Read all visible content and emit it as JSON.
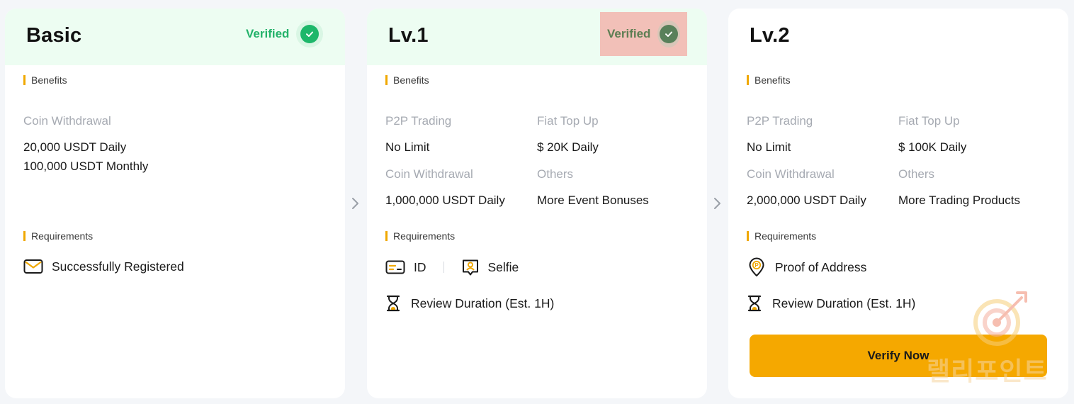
{
  "cards": [
    {
      "title": "Basic",
      "verified_label": "Verified",
      "benefits_label": "Benefits",
      "benefits": [
        {
          "label": "Coin Withdrawal",
          "values": [
            "20,000 USDT Daily",
            "100,000 USDT Monthly"
          ]
        }
      ],
      "requirements_label": "Requirements",
      "requirements": [
        {
          "icon": "email-icon",
          "label": "Successfully Registered"
        }
      ]
    },
    {
      "title": "Lv.1",
      "verified_label": "Verified",
      "benefits_label": "Benefits",
      "benefits": [
        {
          "label": "P2P Trading",
          "values": [
            "No Limit"
          ]
        },
        {
          "label": "Fiat Top Up",
          "values": [
            "$ 20K Daily"
          ]
        },
        {
          "label": "Coin Withdrawal",
          "values": [
            "1,000,000 USDT Daily"
          ]
        },
        {
          "label": "Others",
          "values": [
            "More Event Bonuses"
          ]
        }
      ],
      "requirements_label": "Requirements",
      "requirements": [
        {
          "icon": "id-card-icon",
          "label": "ID"
        },
        {
          "icon": "selfie-icon",
          "label": "Selfie"
        },
        {
          "icon": "hourglass-icon",
          "label": "Review Duration (Est. 1H)"
        }
      ]
    },
    {
      "title": "Lv.2",
      "benefits_label": "Benefits",
      "benefits": [
        {
          "label": "P2P Trading",
          "values": [
            "No Limit"
          ]
        },
        {
          "label": "Fiat Top Up",
          "values": [
            "$ 100K Daily"
          ]
        },
        {
          "label": "Coin Withdrawal",
          "values": [
            "2,000,000 USDT Daily"
          ]
        },
        {
          "label": "Others",
          "values": [
            "More Trading Products"
          ]
        }
      ],
      "requirements_label": "Requirements",
      "requirements": [
        {
          "icon": "location-pin-icon",
          "label": "Proof of Address"
        },
        {
          "icon": "hourglass-icon",
          "label": "Review Duration (Est. 1H)"
        }
      ],
      "button_label": "Verify Now"
    }
  ],
  "watermark_text": "랠리포인트",
  "colors": {
    "accent": "#f5a800",
    "verified_green": "#23b26a",
    "header_bg": "#edfdf2",
    "muted_text": "#a6aab2"
  }
}
